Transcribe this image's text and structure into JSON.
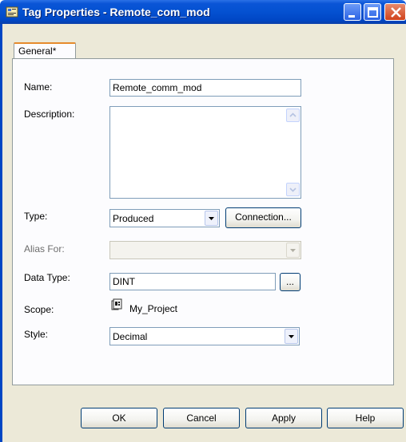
{
  "window": {
    "title": "Tag Properties - Remote_com_mod"
  },
  "tabs": [
    {
      "label": "General*"
    }
  ],
  "form": {
    "name_label": "Name:",
    "name_value": "Remote_comm_mod",
    "description_label": "Description:",
    "description_value": "",
    "type_label": "Type:",
    "type_value": "Produced",
    "connection_button": "Connection...",
    "alias_label": "Alias For:",
    "alias_value": "",
    "data_type_label": "Data Type:",
    "data_type_value": "DINT",
    "browse_button": "...",
    "scope_label": "Scope:",
    "scope_value": "My_Project",
    "style_label": "Style:",
    "style_value": "Decimal"
  },
  "buttons": {
    "ok": "OK",
    "cancel": "Cancel",
    "apply": "Apply",
    "help": "Help"
  },
  "icons": {
    "title": "tag-properties-icon",
    "scope": "project-icon"
  }
}
